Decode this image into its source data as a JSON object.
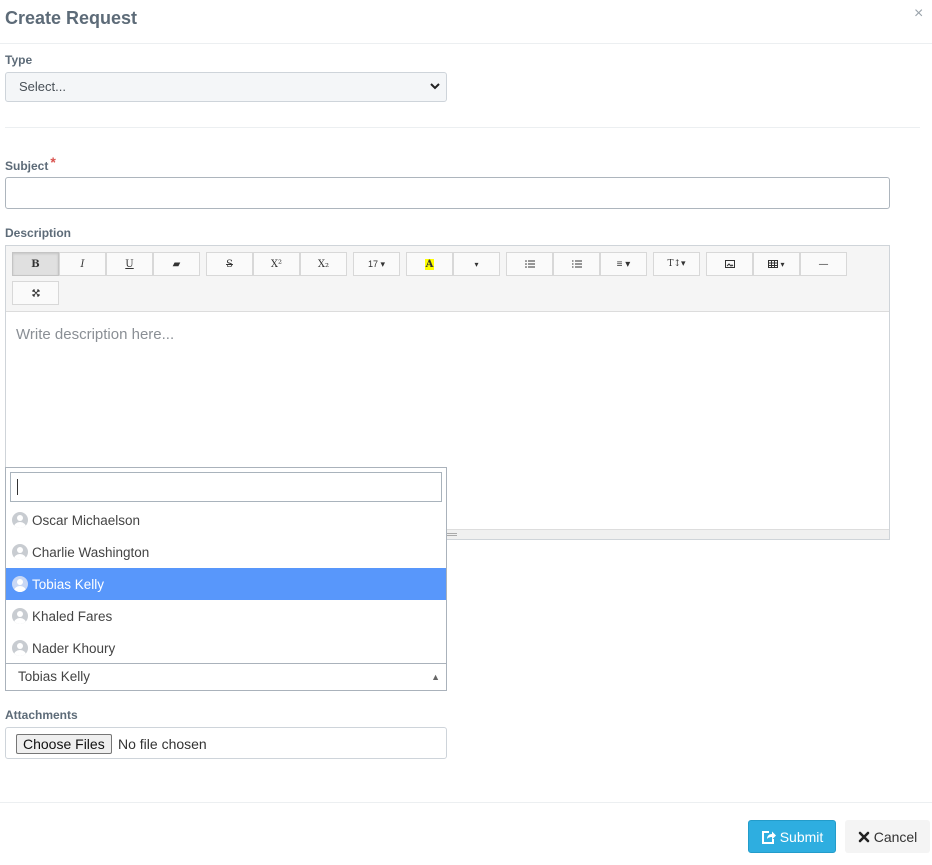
{
  "modal": {
    "title": "Create Request",
    "close_glyph": "×"
  },
  "type_field": {
    "label": "Type",
    "value": "Select..."
  },
  "subject_field": {
    "label": "Subject",
    "required_mark": "*",
    "value": ""
  },
  "description_field": {
    "label": "Description",
    "placeholder": "Write description here...",
    "toolbar": {
      "bold": "B",
      "italic": "I",
      "underline": "U",
      "clear_format": "▰",
      "strikethrough": "S",
      "superscript": "X²",
      "subscript": "X₂",
      "font_size": "17 ▾",
      "highlight": "A",
      "color_dropdown": "▾",
      "unordered_list": "☰",
      "ordered_list": "☷",
      "align": "≡ ▾",
      "style": "T↕▾",
      "image": "▣",
      "table": "▦▾",
      "hr": "—",
      "fullscreen": "⤧"
    }
  },
  "assignee_dropdown": {
    "search_value": "",
    "options": [
      "Oscar Michaelson",
      "Charlie Washington",
      "Tobias Kelly",
      "Khaled Fares",
      "Nader Khoury"
    ],
    "selected": "Tobias Kelly"
  },
  "attachments_field": {
    "label": "Attachments",
    "button_label": "Choose Files",
    "status": "No file chosen"
  },
  "footer": {
    "submit_label": "Submit",
    "cancel_label": "Cancel"
  }
}
